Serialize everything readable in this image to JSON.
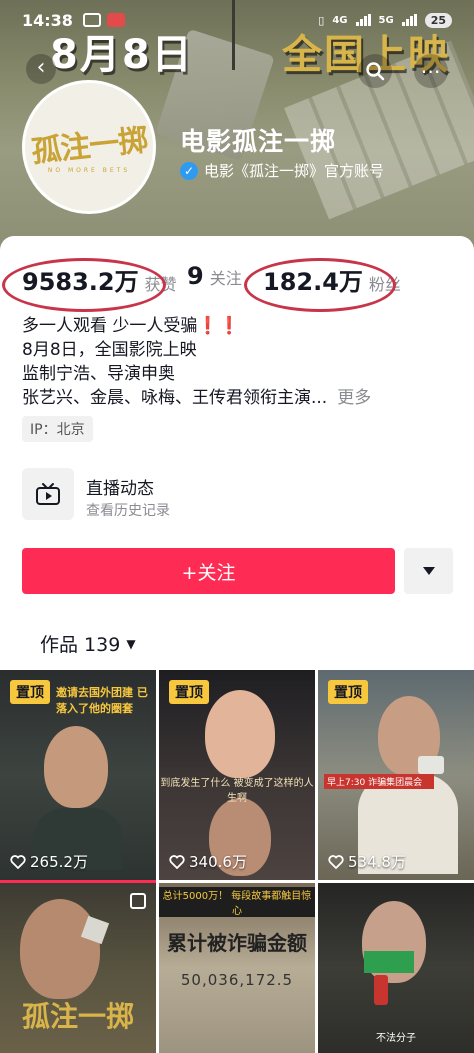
{
  "status_bar": {
    "time": "14:38",
    "network_1": "4G",
    "network_2": "5G",
    "battery": "25"
  },
  "banner": {
    "headline_left": "8月8日",
    "headline_right": "全国上映"
  },
  "profile": {
    "avatar_logo_text": "孤注一掷",
    "avatar_logo_sub": "NO MORE BETS",
    "name": "电影孤注一掷",
    "verified_text": "电影《孤注一掷》官方账号"
  },
  "stats": {
    "likes_value": "9583.2万",
    "likes_label": "获赞",
    "following_value": "9",
    "following_label": "关注",
    "followers_value": "182.4万",
    "followers_label": "粉丝"
  },
  "bio": {
    "lines": [
      "多一人观看 少一人受骗❗❗",
      "8月8日，全国影院上映",
      "监制宁浩、导演申奥",
      "张艺兴、金晨、咏梅、王传君领衔主演..."
    ],
    "more_label": "更多",
    "ip_label": "IP：北京"
  },
  "live": {
    "title": "直播动态",
    "subtitle": "查看历史记录"
  },
  "actions": {
    "follow_label": "+关注"
  },
  "works": {
    "tab_label": "作品 139"
  },
  "videos": [
    {
      "pinned_label": "置顶",
      "views": "265.2万",
      "caption": "邀请去国外团建 已落入了他的圈套"
    },
    {
      "pinned_label": "置顶",
      "views": "340.6万",
      "caption": "到底发生了什么 被变成了这样的人生啊"
    },
    {
      "pinned_label": "置顶",
      "views": "534.8万",
      "caption": "早上7:30 诈骗集团晨会"
    },
    {
      "title": "孤注一掷",
      "caption": ""
    },
    {
      "caption": "总计5000万！ 每段故事都触目惊心",
      "sub": "累计被诈骗金额",
      "number": "50,036,172.5"
    },
    {
      "caption": "不法分子"
    }
  ],
  "colors": {
    "accent": "#fe2c55",
    "pin": "#f7c73d",
    "annotation_ring": "#c8354a"
  }
}
